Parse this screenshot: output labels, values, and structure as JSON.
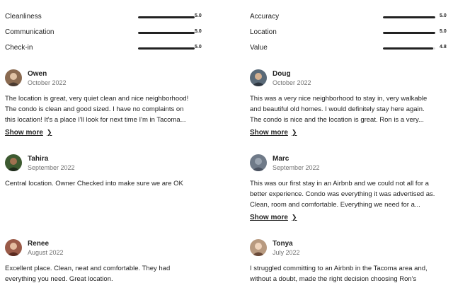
{
  "ratings": [
    {
      "label": "Cleanliness",
      "score": "5.0",
      "value": 5.0
    },
    {
      "label": "Communication",
      "score": "5.0",
      "value": 5.0
    },
    {
      "label": "Check-in",
      "score": "5.0",
      "value": 5.0
    },
    {
      "label": "Accuracy",
      "score": "5.0",
      "value": 5.0
    },
    {
      "label": "Location",
      "score": "5.0",
      "value": 5.0
    },
    {
      "label": "Value",
      "score": "4.8",
      "value": 4.8
    }
  ],
  "rating_max": 5,
  "reviews": [
    {
      "name": "Owen",
      "date": "October 2022",
      "lines": [
        "The location is great, very quiet clean and nice neighborhood!",
        "The condo is clean and good sized. I have no complaints on",
        "this location! It's a place I'll look for next time I'm in Tacoma..."
      ],
      "show_more": "Show more",
      "avatar_color": "#8a6a50"
    },
    {
      "name": "Doug",
      "date": "October 2022",
      "lines": [
        "This was a very nice neighborhood to stay in, very walkable",
        "and beautiful old homes. I would definitely stay here again.",
        "The condo is nice and the location is great. Ron is a very..."
      ],
      "show_more": "Show more",
      "avatar_color": "#5a6a78"
    },
    {
      "name": "Tahira",
      "date": "September 2022",
      "lines": [
        "Central location. Owner Checked into make sure we are OK"
      ],
      "show_more": "",
      "avatar_color": "#3d5a30"
    },
    {
      "name": "Marc",
      "date": "September 2022",
      "lines": [
        "This was our first stay in an Airbnb and we could not all for a",
        "better experience. Condo was everything it was advertised as.",
        "Clean, room and comfortable. Everything we need for a..."
      ],
      "show_more": "Show more",
      "avatar_color": "#6f7a88"
    },
    {
      "name": "Renee",
      "date": "August 2022",
      "lines": [
        "Excellent place. Clean, neat and comfortable. They had",
        "everything you need. Great location."
      ],
      "show_more": "",
      "avatar_color": "#9a5a48"
    },
    {
      "name": "Tonya",
      "date": "July 2022",
      "lines": [
        "I struggled committing to an Airbnb in the Tacoma area and,",
        "without a doubt, made the right decision choosing Ron's"
      ],
      "show_more": "",
      "avatar_color": "#b89a80"
    }
  ]
}
